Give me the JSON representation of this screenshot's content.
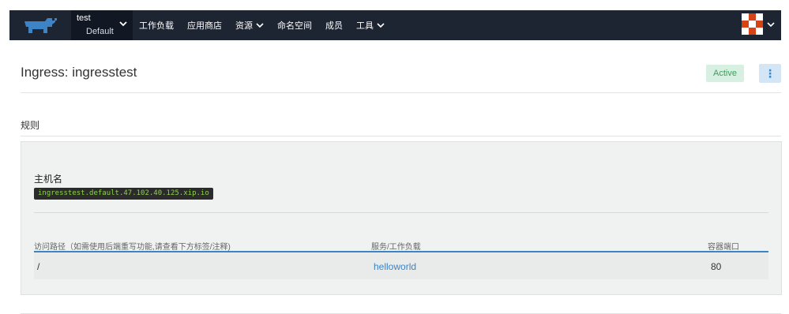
{
  "nav": {
    "project_name": "test",
    "cluster_name": "Default",
    "items": [
      {
        "label": "工作负载",
        "has_dropdown": false
      },
      {
        "label": "应用商店",
        "has_dropdown": false
      },
      {
        "label": "资源",
        "has_dropdown": true
      },
      {
        "label": "命名空间",
        "has_dropdown": false
      },
      {
        "label": "成员",
        "has_dropdown": false
      },
      {
        "label": "工具",
        "has_dropdown": true
      }
    ]
  },
  "header": {
    "title": "Ingress: ingresstest",
    "status": "Active",
    "more_icon": "⋮"
  },
  "rules": {
    "section_label": "规则",
    "host_label": "主机名",
    "host_value": "ingresstest.default.47.102.40.125.xip.io",
    "columns": {
      "path": "访问路径（如需使用后端重写功能,请查看下方标签/注释)",
      "target": "服务/工作负载",
      "port": "容器端口"
    },
    "rows": [
      {
        "path": "/",
        "target": "helloworld",
        "port": "80"
      }
    ]
  },
  "colors": {
    "topbar": "#1e2532",
    "accent": "#3d84c6",
    "status_bg": "#d8f0e1",
    "status_text": "#3aa05c"
  }
}
